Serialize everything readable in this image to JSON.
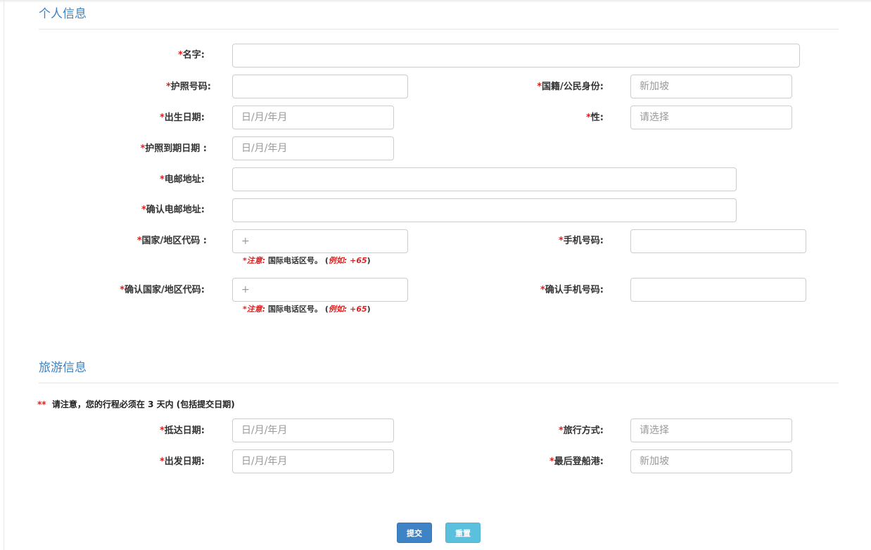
{
  "sections": {
    "personal_title": "个人信息",
    "travel_title": "旅游信息"
  },
  "required_mark": "*",
  "fields": {
    "name_label": "名字:",
    "passport_no_label": "护照号码:",
    "nationality_label": "国籍/公民身份:",
    "nationality_placeholder": "新加坡",
    "dob_label": "出生日期:",
    "dob_placeholder": "日/月/年月",
    "gender_label": "性:",
    "gender_placeholder": "请选择",
    "passport_expiry_label": "护照到期日期 :",
    "passport_expiry_placeholder": "日/月/年月",
    "email_label": "电邮地址:",
    "email_confirm_label": "确认电邮地址:",
    "country_code_label": "国家/地区代码 :",
    "country_code_placeholder": "+",
    "mobile_label": "手机号码:",
    "country_code_confirm_label": "确认国家/地区代码:",
    "country_code_confirm_placeholder": "+",
    "mobile_confirm_label": "确认手机号码:"
  },
  "hint": {
    "note_label": "*注意:",
    "text": "国际电话区号。",
    "example_open": "(",
    "example": "例如: +65",
    "example_close": ")"
  },
  "travel": {
    "notice_mark": "**",
    "notice_text": "请注意，您的行程必须在 3 天内 (包括提交日期)",
    "arrival_label": "抵达日期:",
    "arrival_placeholder": "日/月/年月",
    "mode_label": "旅行方式:",
    "mode_placeholder": "请选择",
    "departure_label": "出发日期:",
    "departure_placeholder": "日/月/年月",
    "last_port_label": "最后登船港:",
    "last_port_placeholder": "新加坡"
  },
  "buttons": {
    "submit": "提交",
    "reset": "重置"
  },
  "colors": {
    "accent": "#3f83c0",
    "required": "#e02020",
    "submit_bg": "#3f83c7",
    "reset_bg": "#5bc0de"
  }
}
